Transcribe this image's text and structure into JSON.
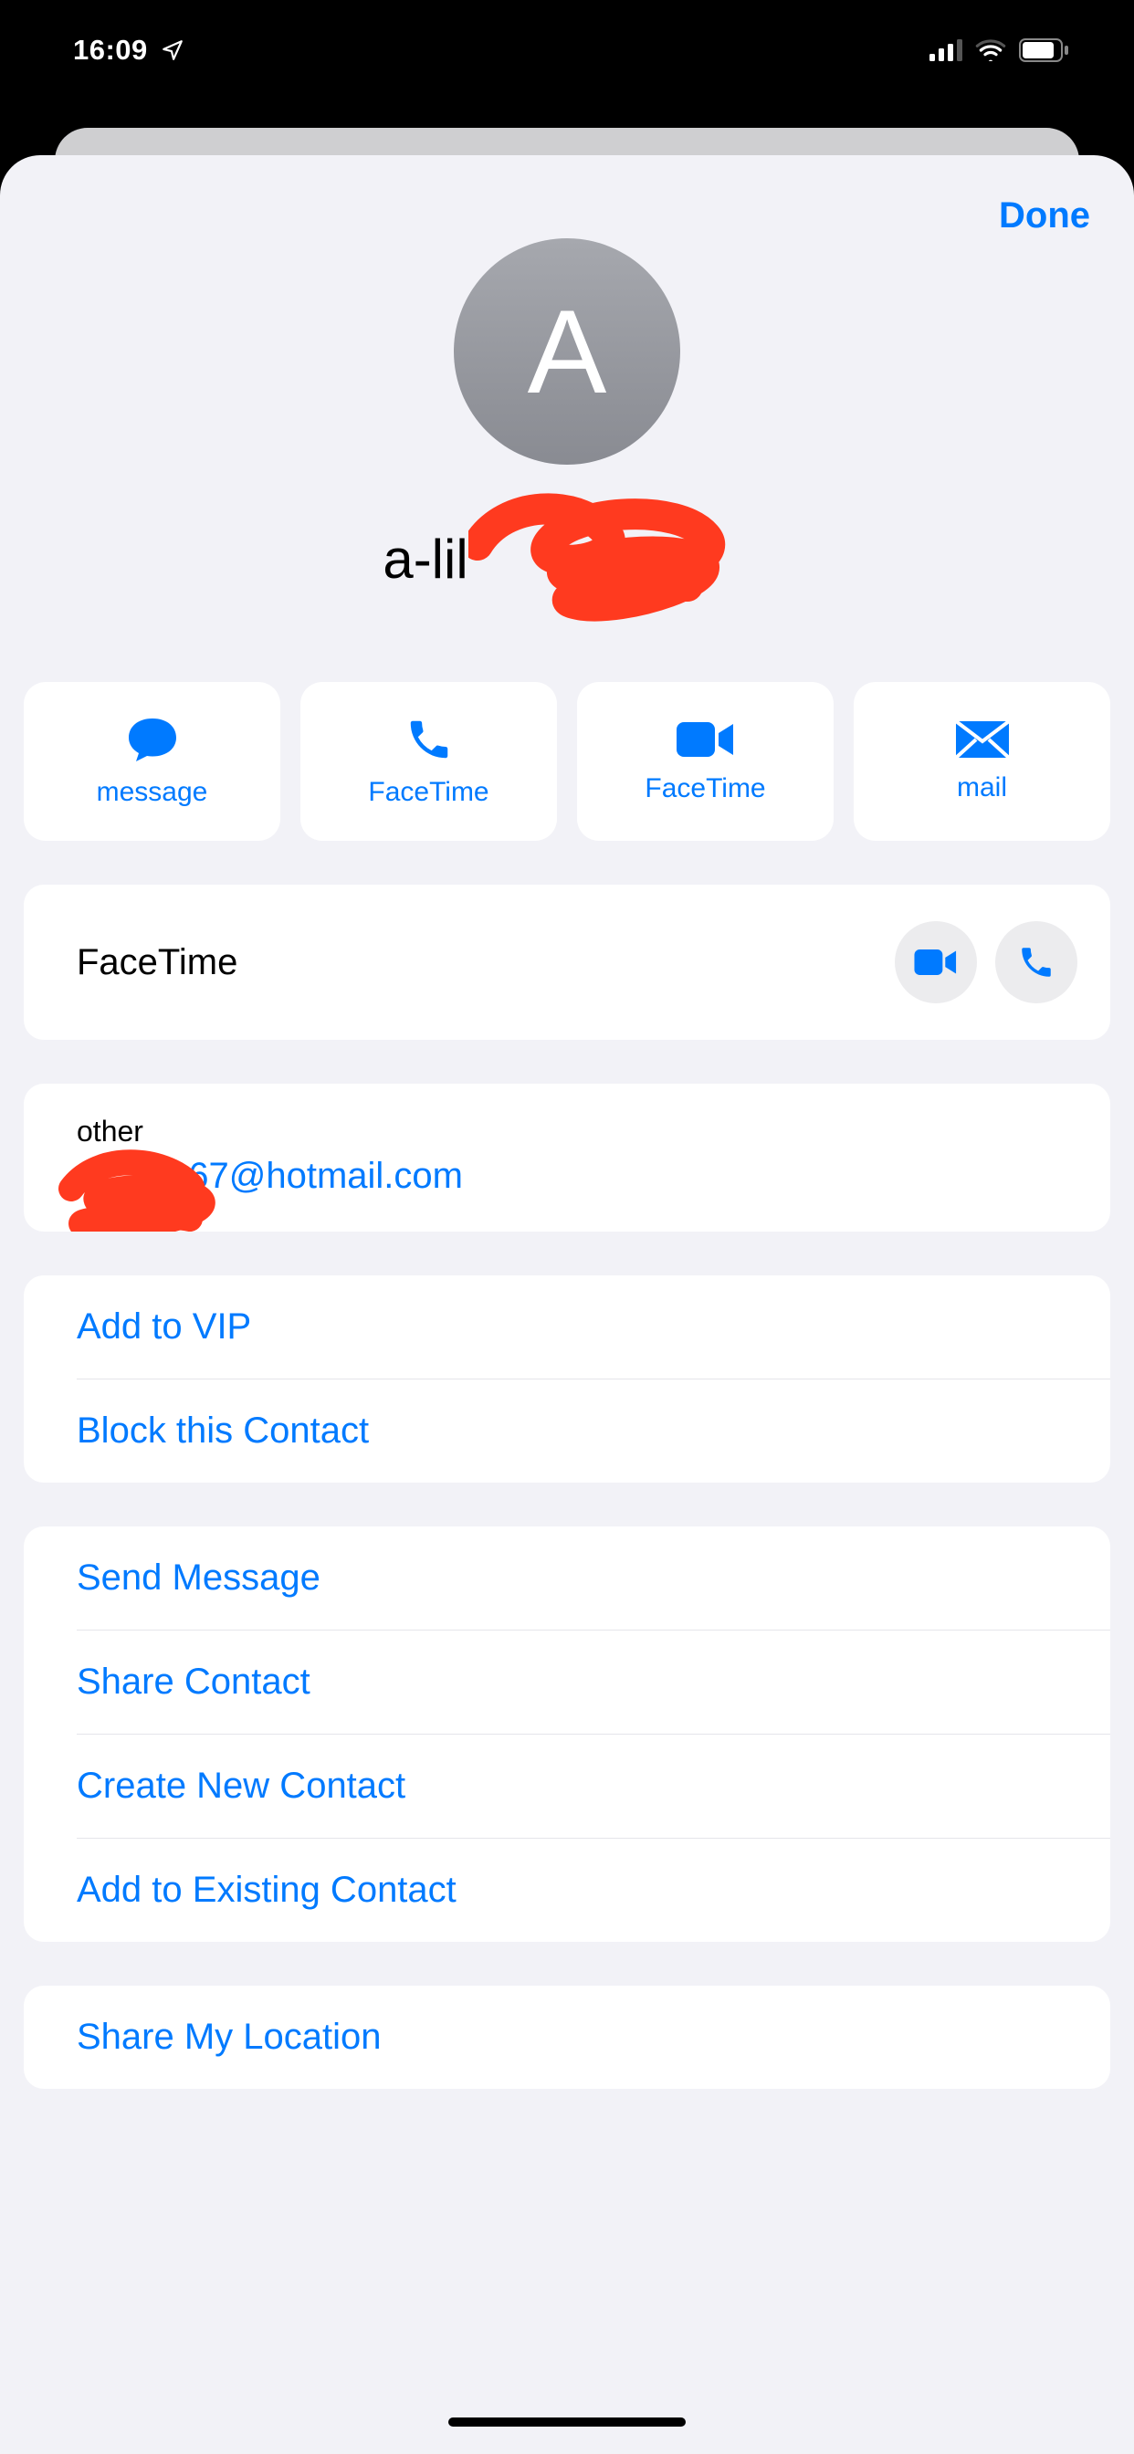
{
  "status": {
    "time": "16:09"
  },
  "nav": {
    "done": "Done"
  },
  "contact": {
    "initial": "A",
    "name_visible": "a-lil"
  },
  "actions": {
    "message": "message",
    "facetime_audio": "FaceTime",
    "facetime_video": "FaceTime",
    "mail": "mail"
  },
  "facetime_row": {
    "label": "FaceTime"
  },
  "email": {
    "kind": "other",
    "visible_suffix": "667@hotmail.com"
  },
  "group1": {
    "add_vip": "Add to VIP",
    "block": "Block this Contact"
  },
  "group2": {
    "send_message": "Send Message",
    "share_contact": "Share Contact",
    "create_new": "Create New Contact",
    "add_existing": "Add to Existing Contact"
  },
  "group3": {
    "share_location": "Share My Location"
  }
}
